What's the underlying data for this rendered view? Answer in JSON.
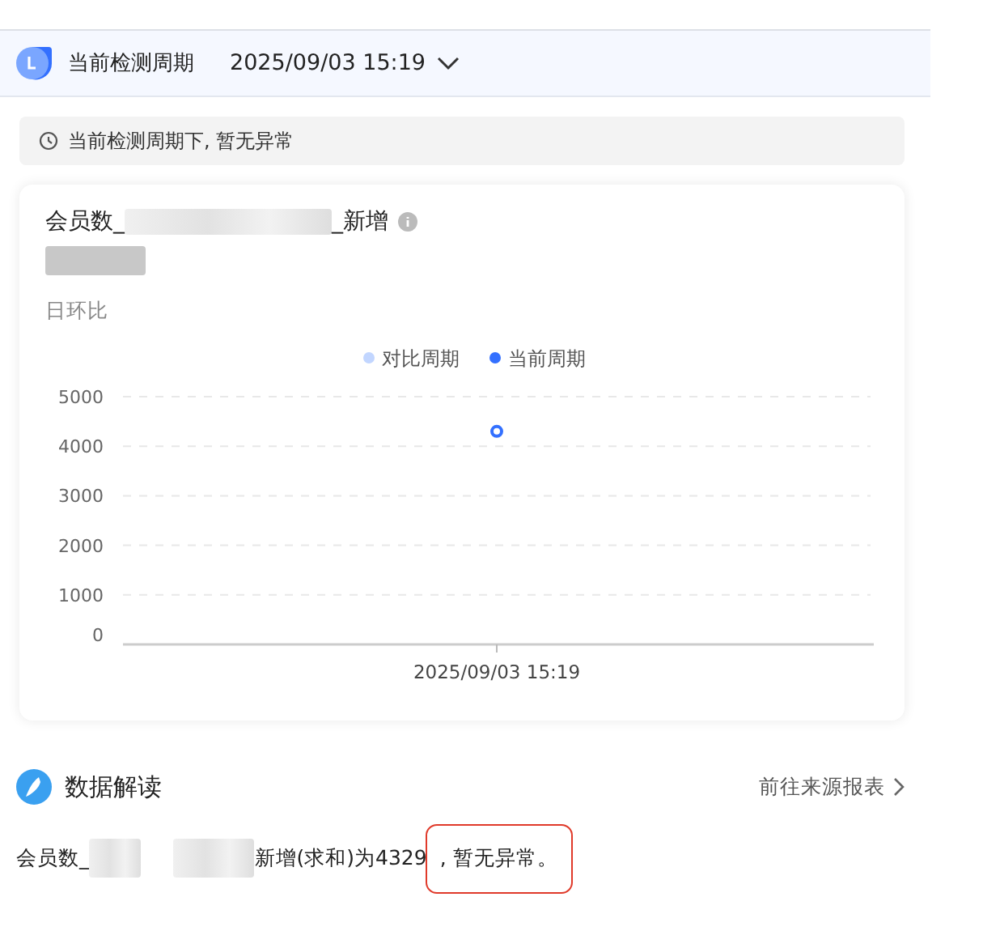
{
  "header": {
    "title": "当前检测周期",
    "period": "2025/09/03 15:19"
  },
  "notice": {
    "text": "当前检测周期下, 暂无异常"
  },
  "metric_card": {
    "title_start": "会员数_",
    "title_end": "_新增",
    "comparison_label": "日环比",
    "chart_data": {
      "type": "line",
      "categories": [
        "2025/09/03 15:19"
      ],
      "ylim": [
        0,
        5000
      ],
      "yticks": [
        0,
        1000,
        2000,
        3000,
        4000,
        5000
      ],
      "grid": true,
      "series": [
        {
          "name": "对比周期",
          "color": "#c2d6ff",
          "values": [
            null
          ]
        },
        {
          "name": "当前周期",
          "color": "#3370ff",
          "marker": true,
          "values": [
            4300
          ]
        }
      ]
    }
  },
  "interpretation": {
    "title": "数据解读",
    "link": "前往来源报表",
    "sentence_start": "会员数_",
    "sentence_end": "新增(求和)为4329",
    "highlighted": ", 暂无异常。"
  }
}
